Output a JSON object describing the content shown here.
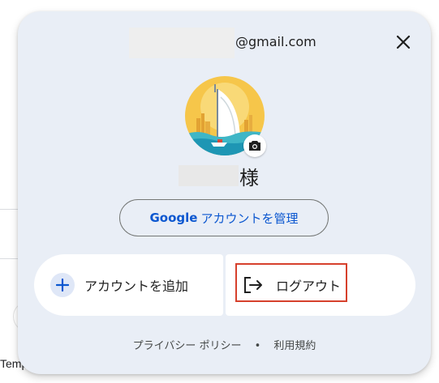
{
  "background": {
    "partial_text": "Temp"
  },
  "account": {
    "email_domain": "@gmail.com",
    "name_suffix": "様",
    "manage_button": {
      "brand": "Google",
      "label": "アカウントを管理"
    }
  },
  "actions": {
    "add_account_label": "アカウントを追加",
    "logout_label": "ログアウト"
  },
  "footer": {
    "privacy_label": "プライバシー ポリシー",
    "separator": "•",
    "terms_label": "利用規約"
  },
  "icons": {
    "close": "close-icon",
    "camera": "camera-icon",
    "add": "plus-icon",
    "logout": "logout-icon"
  },
  "colors": {
    "popup_bg": "#e9eef6",
    "accent": "#0b57d0",
    "highlight": "#d6402c"
  }
}
